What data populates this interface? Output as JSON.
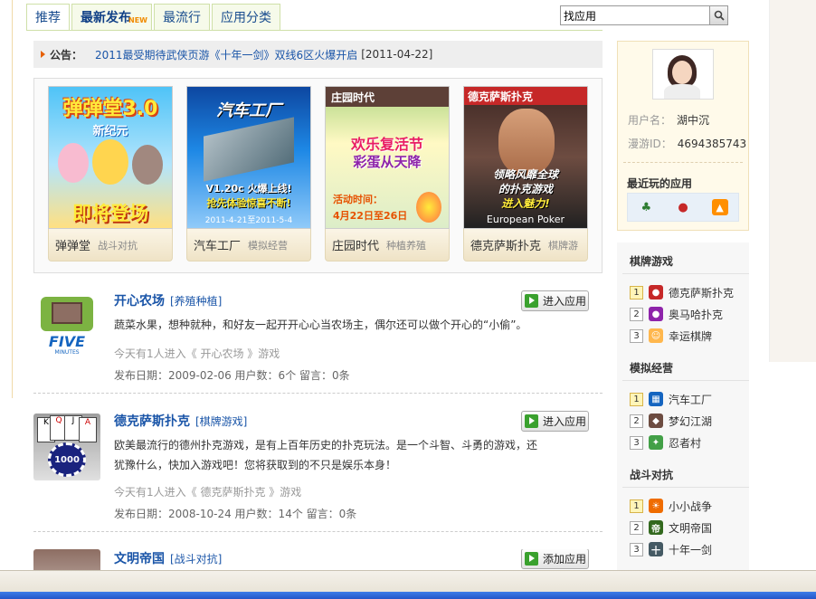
{
  "tabs": [
    {
      "label": "推荐",
      "active": true
    },
    {
      "label": "最新发布",
      "badge": "NEW"
    },
    {
      "label": "最流行"
    },
    {
      "label": "应用分类"
    }
  ],
  "search": {
    "value": "找应用"
  },
  "notice": {
    "label": "公告：",
    "link": "2011最受期待武侠页游《十年一剑》双线6区火爆开启",
    "date": "[2011-04-22]"
  },
  "featured": [
    {
      "name": "弹弹堂",
      "category": "战斗对抗",
      "art": [
        "弹弹堂3.0",
        "新纪元",
        "即将登场"
      ]
    },
    {
      "name": "汽车工厂",
      "category": "模拟经营",
      "art": [
        "汽车工厂",
        "V1.20c 火爆上线!",
        "抢先体验惊喜不断!",
        "2011-4-21至2011-5-4"
      ]
    },
    {
      "name": "庄园时代",
      "category": "种植养殖",
      "art": [
        "庄园时代",
        "欢乐复活节",
        "彩蛋从天降",
        "活动时间：",
        "4月22日至26日"
      ]
    },
    {
      "name": "德克萨斯扑克",
      "category": "棋牌游",
      "art": [
        "德克萨斯扑克",
        "领略风靡全球",
        "的扑克游戏",
        "进入魅力!",
        "European Poker"
      ]
    }
  ],
  "apps": [
    {
      "title": "开心农场",
      "category": "[养殖种植]",
      "icon_text": "FIVE",
      "icon_sub": "MINUTES",
      "desc": "蔬菜水果，想种就种，和好友一起开开心心当农场主，偶尔还可以做个开心的“小偷”。",
      "today": "今天有1人进入《 开心农场 》游戏",
      "meta": "发布日期：2009-02-06 用户数：6个   留言：0条",
      "button": "进入应用"
    },
    {
      "title": "德克萨斯扑克",
      "category": "[棋牌游戏]",
      "icon_text": "1000",
      "desc": "欧美最流行的德州扑克游戏，是有上百年历史的扑克玩法。是一个斗智、斗勇的游戏，还犹豫什么，快加入游戏吧！您将获取到的不只是娱乐本身！",
      "today": "今天有1人进入《 德克萨斯扑克 》游戏",
      "meta": "发布日期：2008-10-24 用户数：14个   留言：0条",
      "button": "进入应用"
    },
    {
      "title": "文明帝国",
      "category": "[战斗对抗]",
      "button": "添加应用"
    }
  ],
  "profile": {
    "username_label": "用户名：",
    "username": "湖中沉",
    "id_label": "漫游ID：",
    "id": "4694385743",
    "recent_title": "最近玩的应用"
  },
  "rankings": [
    {
      "title": "棋牌游戏",
      "items": [
        {
          "rank": "1",
          "name": "德克萨斯扑克"
        },
        {
          "rank": "2",
          "name": "奥马哈扑克"
        },
        {
          "rank": "3",
          "name": "幸运棋牌"
        }
      ]
    },
    {
      "title": "模拟经营",
      "items": [
        {
          "rank": "1",
          "name": "汽车工厂"
        },
        {
          "rank": "2",
          "name": "梦幻江湖"
        },
        {
          "rank": "3",
          "name": "忍者村"
        }
      ]
    },
    {
      "title": "战斗对抗",
      "items": [
        {
          "rank": "1",
          "name": "小小战争"
        },
        {
          "rank": "2",
          "name": "文明帝国"
        },
        {
          "rank": "3",
          "name": "十年一剑"
        }
      ]
    }
  ]
}
